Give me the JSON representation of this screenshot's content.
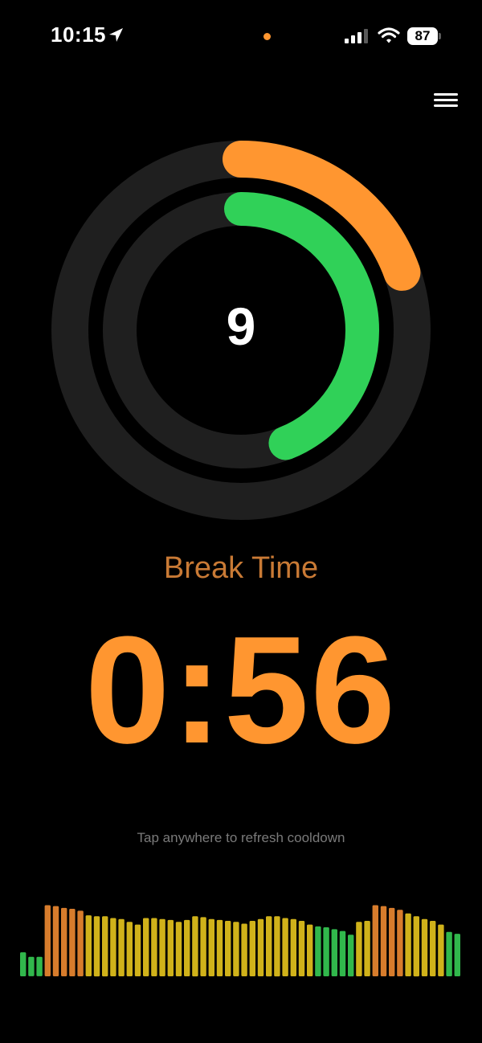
{
  "status_bar": {
    "time": "10:15",
    "battery": "87",
    "icons": [
      "location-arrow-icon",
      "orange-dot-indicator",
      "cellular-signal-icon",
      "wifi-icon",
      "battery-icon"
    ]
  },
  "menu": {
    "icon": "hamburger-menu-icon"
  },
  "rings": {
    "count": "9",
    "outer_progress": 0.195,
    "inner_progress": 0.44,
    "colors": {
      "track": "#1f1f1f",
      "outer": "#ff9630",
      "inner": "#30d158"
    }
  },
  "timer": {
    "mode": "Break Time",
    "countdown": "0:56"
  },
  "hint": "Tap anywhere to refresh cooldown",
  "level_meter": {
    "levels": [
      0.26,
      0.21,
      0.21,
      0.77,
      0.76,
      0.74,
      0.73,
      0.71,
      0.66,
      0.65,
      0.65,
      0.63,
      0.62,
      0.59,
      0.56,
      0.63,
      0.63,
      0.62,
      0.61,
      0.59,
      0.61,
      0.65,
      0.64,
      0.62,
      0.61,
      0.6,
      0.59,
      0.57,
      0.6,
      0.62,
      0.65,
      0.65,
      0.63,
      0.62,
      0.6,
      0.56,
      0.54,
      0.53,
      0.51,
      0.49,
      0.45,
      0.59,
      0.6,
      0.77,
      0.76,
      0.74,
      0.72,
      0.68,
      0.65,
      0.62,
      0.6,
      0.56,
      0.48,
      0.46
    ],
    "colors": {
      "low": "#31b84c",
      "mid": "#d0b21a",
      "high": "#d77c2c"
    }
  }
}
